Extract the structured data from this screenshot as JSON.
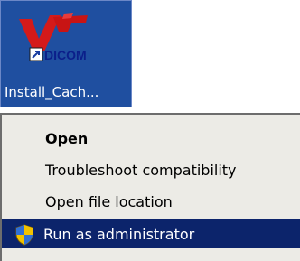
{
  "desktop": {
    "icon_label": "Install_Cach...",
    "icon_art_text": "DICOM",
    "background_color": "#1f4fa0"
  },
  "context_menu": {
    "items": [
      {
        "label": "Open",
        "bold": true,
        "highlighted": false
      },
      {
        "label": "Troubleshoot compatibility",
        "bold": false,
        "highlighted": false
      },
      {
        "label": "Open file location",
        "bold": false,
        "highlighted": false
      },
      {
        "label": "Run as administrator",
        "bold": false,
        "highlighted": true,
        "icon": "uac-shield-icon"
      }
    ],
    "highlight_color": "#0c246b",
    "background_color": "#ecebe6"
  }
}
